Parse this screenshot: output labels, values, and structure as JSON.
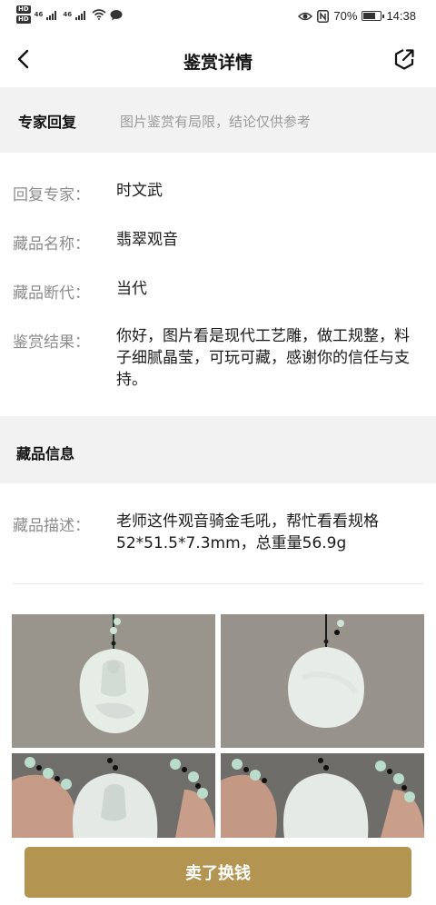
{
  "status_bar": {
    "hd_top": "HD",
    "hd_bottom": "HD",
    "signal_1": "46",
    "signal_2": "46",
    "battery_percent": "70%",
    "time": "14:38"
  },
  "header": {
    "title": "鉴赏详情",
    "back_icon": "chevron-left-icon",
    "share_icon": "share-icon"
  },
  "expert_section": {
    "title": "专家回复",
    "note": "图片鉴赏有局限，结论仅供参考"
  },
  "appraisal": {
    "expert_label": "回复专家：",
    "expert_value": "时文武",
    "name_label": "藏品名称：",
    "name_value": "翡翠观音",
    "era_label": "藏品断代：",
    "era_value": "当代",
    "result_label": "鉴赏结果：",
    "result_value": "你好，图片看是现代工艺雕，做工规整，料子细腻晶莹，可玩可藏，感谢你的信任与支持。"
  },
  "collection_section": {
    "title": "藏品信息",
    "desc_label": "藏品描述：",
    "desc_value": "老师这件观音骑金毛吼，帮忙看看规格52*51.5*7.3mm，总重量56.9g"
  },
  "photos": [
    {
      "name": "front-view"
    },
    {
      "name": "back-view"
    },
    {
      "name": "front-in-hand"
    },
    {
      "name": "back-in-hand"
    }
  ],
  "bottom": {
    "sell_label": "卖了换钱",
    "accent_color": "#b39451"
  }
}
